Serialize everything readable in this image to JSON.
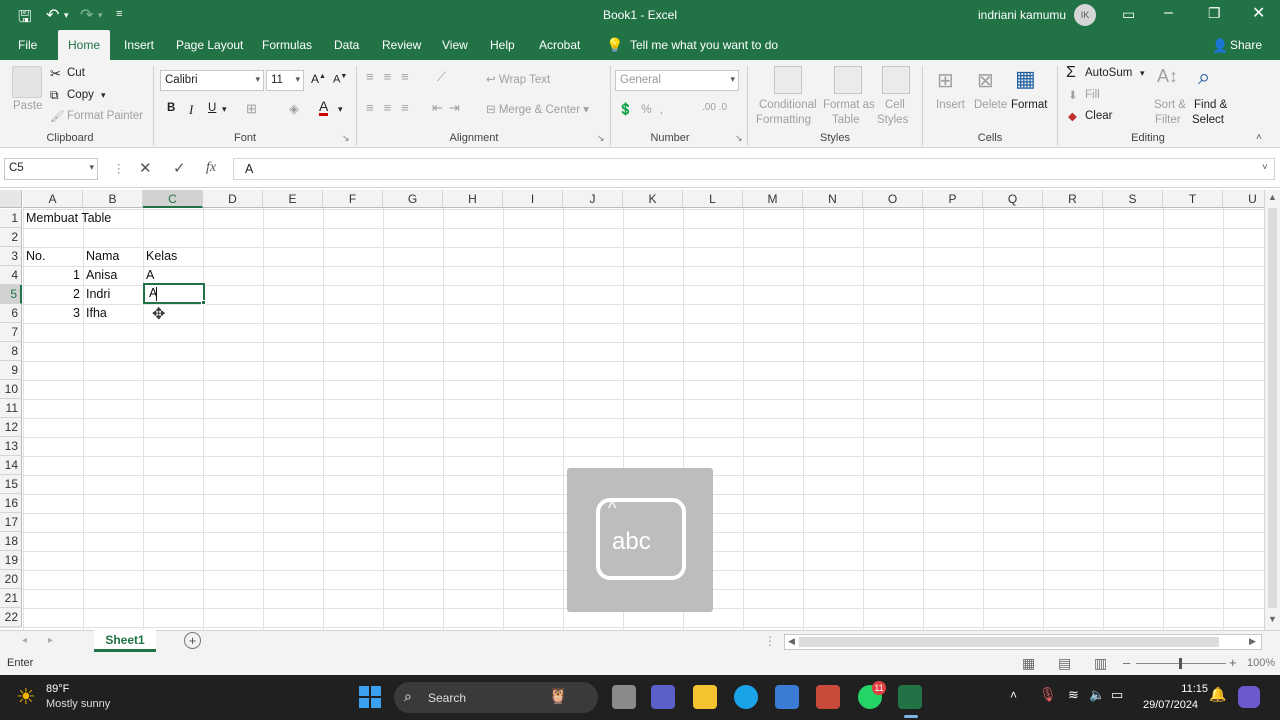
{
  "titlebar": {
    "title": "Book1  -  Excel",
    "user": "indriani kamumu",
    "initials": "IK"
  },
  "tabs": [
    {
      "label": "File"
    },
    {
      "label": "Home",
      "active": true
    },
    {
      "label": "Insert"
    },
    {
      "label": "Page Layout"
    },
    {
      "label": "Formulas"
    },
    {
      "label": "Data"
    },
    {
      "label": "Review"
    },
    {
      "label": "View"
    },
    {
      "label": "Help"
    },
    {
      "label": "Acrobat"
    }
  ],
  "tell_me": "Tell me what you want to do",
  "share": "Share",
  "ribbon": {
    "clipboard": {
      "paste": "Paste",
      "cut": "Cut",
      "copy": "Copy",
      "format_painter": "Format Painter",
      "label": "Clipboard"
    },
    "font": {
      "name": "Calibri",
      "size": "11",
      "bold": "B",
      "italic": "I",
      "underline": "U",
      "label": "Font"
    },
    "alignment": {
      "wrap_text": "Wrap Text",
      "merge_center": "Merge & Center",
      "label": "Alignment"
    },
    "number": {
      "format": "General",
      "label": "Number"
    },
    "styles": {
      "conditional": "Conditional",
      "formatting": "Formatting",
      "format_as": "Format as",
      "table": "Table",
      "cell": "Cell",
      "cell_styles": "Styles",
      "label": "Styles"
    },
    "cells": {
      "insert": "Insert",
      "delete": "Delete",
      "format": "Format",
      "label": "Cells"
    },
    "editing": {
      "autosum": "AutoSum",
      "fill": "Fill",
      "clear": "Clear",
      "sort": "Sort &",
      "filter": "Filter",
      "find": "Find &",
      "select": "Select",
      "label": "Editing"
    }
  },
  "formula_bar": {
    "name_box": "C5",
    "fx": "fx",
    "value": "A"
  },
  "columns": [
    "A",
    "B",
    "C",
    "D",
    "E",
    "F",
    "G",
    "H",
    "I",
    "J",
    "K",
    "L",
    "M",
    "N",
    "O",
    "P",
    "Q",
    "R",
    "S",
    "T",
    "U"
  ],
  "rows": [
    "1",
    "2",
    "3",
    "4",
    "5",
    "6",
    "7",
    "8",
    "9",
    "10",
    "11",
    "12",
    "13",
    "14",
    "15",
    "16",
    "17",
    "18",
    "19",
    "20",
    "21",
    "22"
  ],
  "cells": {
    "A1": "Membuat Table",
    "A3": "No.",
    "B3": "Nama",
    "C3": "Kelas",
    "A4": "1",
    "B4": "Anisa",
    "C4": "A",
    "A5": "2",
    "B5": "Indri",
    "C5": "A",
    "A6": "3",
    "B6": "Ifha"
  },
  "overlay": {
    "text": "abc"
  },
  "sheet": {
    "tab": "Sheet1"
  },
  "status": {
    "mode": "Enter",
    "zoom": "100%"
  },
  "taskbar": {
    "weather_temp": "89°F",
    "weather_desc": "Mostly sunny",
    "search": "Search",
    "time": "11:15",
    "date": "29/07/2024",
    "badge": "11"
  },
  "colors": {
    "excel_green": "#217346",
    "taskbar": "#202020"
  }
}
